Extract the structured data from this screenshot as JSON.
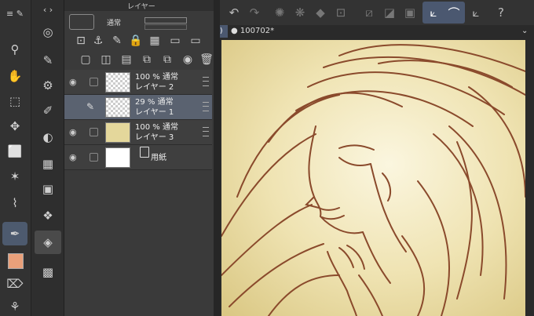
{
  "panel": {
    "title": "レイヤー",
    "blend_mode": "通常"
  },
  "layers": [
    {
      "opacity": "100 %",
      "mode": "通常",
      "name": "レイヤー 2",
      "visible": true
    },
    {
      "opacity": "29 %",
      "mode": "通常",
      "name": "レイヤー 1",
      "selected": true
    },
    {
      "opacity": "100 %",
      "mode": "通常",
      "name": "レイヤー 3",
      "visible": true
    },
    {
      "name": "用紙",
      "visible": true
    }
  ],
  "document": {
    "tab_title": "100702*"
  },
  "colors": {
    "accent": "#5a6270",
    "lineart": "#8a4a2c",
    "canvas_bg": "#f3ecc8"
  },
  "icons": {
    "tools": [
      "zoom-icon",
      "hand-icon",
      "transform-icon",
      "move-icon",
      "selection-icon",
      "magic-wand-icon",
      "eyedropper-icon",
      "pen-icon",
      "color-swatch-icon",
      "eraser-icon",
      "brush-icon"
    ]
  }
}
